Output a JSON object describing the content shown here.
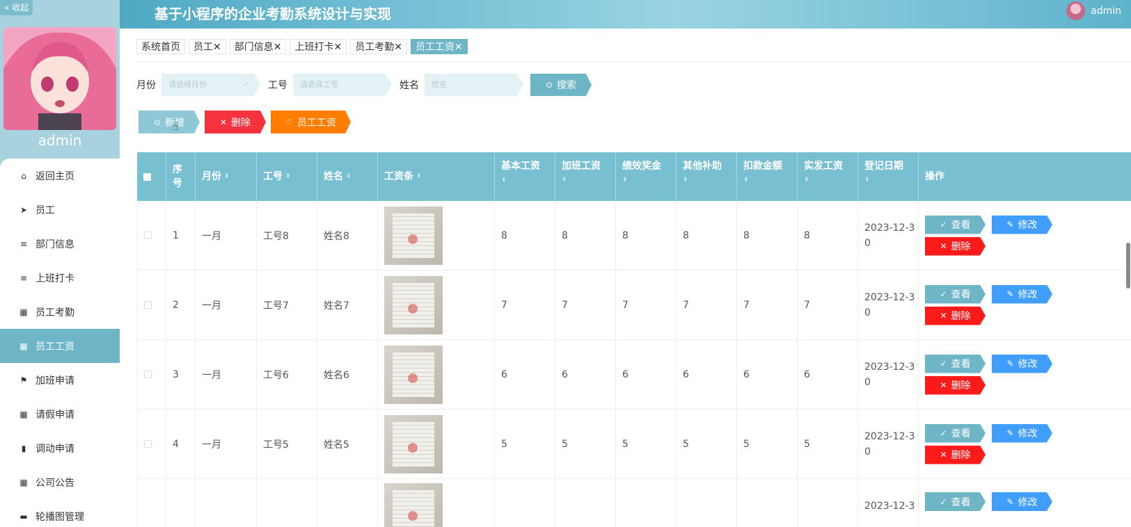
{
  "sidebar": {
    "collapse_label": "« 收起",
    "username": "admin",
    "items": [
      {
        "label": "返回主页",
        "icon": "home-icon",
        "glyph": "⌂"
      },
      {
        "label": "员工",
        "icon": "send-icon",
        "glyph": "➤"
      },
      {
        "label": "部门信息",
        "icon": "list-icon",
        "glyph": "≡"
      },
      {
        "label": "上班打卡",
        "icon": "list-icon",
        "glyph": "≡"
      },
      {
        "label": "员工考勤",
        "icon": "grid-icon",
        "glyph": "▦"
      },
      {
        "label": "员工工资",
        "icon": "grid-icon",
        "glyph": "▦"
      },
      {
        "label": "加班申请",
        "icon": "flag-icon",
        "glyph": "⚑"
      },
      {
        "label": "请假申请",
        "icon": "grid-icon",
        "glyph": "▦"
      },
      {
        "label": "调动申请",
        "icon": "bar-chart-icon",
        "glyph": "▮"
      },
      {
        "label": "公司公告",
        "icon": "grid-icon",
        "glyph": "▦"
      },
      {
        "label": "轮播图管理",
        "icon": "ticket-icon",
        "glyph": "▬"
      }
    ]
  },
  "header": {
    "title": "基于小程序的企业考勤系统设计与实现",
    "username": "admin"
  },
  "tabs": [
    {
      "label": "系统首页",
      "closable": false
    },
    {
      "label": "员工✕",
      "closable": true
    },
    {
      "label": "部门信息✕",
      "closable": true
    },
    {
      "label": "上班打卡✕",
      "closable": true
    },
    {
      "label": "员工考勤✕",
      "closable": true
    },
    {
      "label": "员工工资✕",
      "closable": true
    }
  ],
  "search": {
    "month_label": "月份",
    "month_placeholder": "请选择月份",
    "emp_no_label": "工号",
    "emp_no_placeholder": "请选择工号",
    "name_label": "姓名",
    "name_placeholder": "姓名",
    "search_button": "搜索"
  },
  "actions": {
    "add_label": "新增",
    "delete_label": "删除",
    "salary_label": "员工工资"
  },
  "colors": {
    "primary": "#6fb5c8",
    "danger": "#f5333f",
    "orange": "#ff7d00",
    "edit": "#409eff",
    "header_bg": "#77bfd1"
  },
  "table": {
    "headers": {
      "index": "序号",
      "month": "月份",
      "emp_no": "工号",
      "name": "姓名",
      "payslip": "工资条",
      "base": "基本工资",
      "overtime": "加班工资",
      "bonus": "绩效奖金",
      "allowance": "其他补助",
      "deduction": "扣款金额",
      "net": "实发工资",
      "date": "登记日期",
      "ops": "操作"
    },
    "op_labels": {
      "view": "查看",
      "edit": "修改",
      "delete": "删除"
    },
    "rows": [
      {
        "index": "1",
        "month": "一月",
        "emp_no": "工号8",
        "name": "姓名8",
        "base": "8",
        "overtime": "8",
        "bonus": "8",
        "allowance": "8",
        "deduction": "8",
        "net": "8",
        "date_l1": "2023-12-3",
        "date_l2": "0"
      },
      {
        "index": "2",
        "month": "一月",
        "emp_no": "工号7",
        "name": "姓名7",
        "base": "7",
        "overtime": "7",
        "bonus": "7",
        "allowance": "7",
        "deduction": "7",
        "net": "7",
        "date_l1": "2023-12-3",
        "date_l2": "0"
      },
      {
        "index": "3",
        "month": "一月",
        "emp_no": "工号6",
        "name": "姓名6",
        "base": "6",
        "overtime": "6",
        "bonus": "6",
        "allowance": "6",
        "deduction": "6",
        "net": "6",
        "date_l1": "2023-12-3",
        "date_l2": "0"
      },
      {
        "index": "4",
        "month": "一月",
        "emp_no": "工号5",
        "name": "姓名5",
        "base": "5",
        "overtime": "5",
        "bonus": "5",
        "allowance": "5",
        "deduction": "5",
        "net": "5",
        "date_l1": "2023-12-3",
        "date_l2": "0"
      },
      {
        "index": "",
        "month": "",
        "emp_no": "",
        "name": "",
        "base": "",
        "overtime": "",
        "bonus": "",
        "allowance": "",
        "deduction": "",
        "net": "",
        "date_l1": "2023-12-3",
        "date_l2": ""
      }
    ]
  }
}
